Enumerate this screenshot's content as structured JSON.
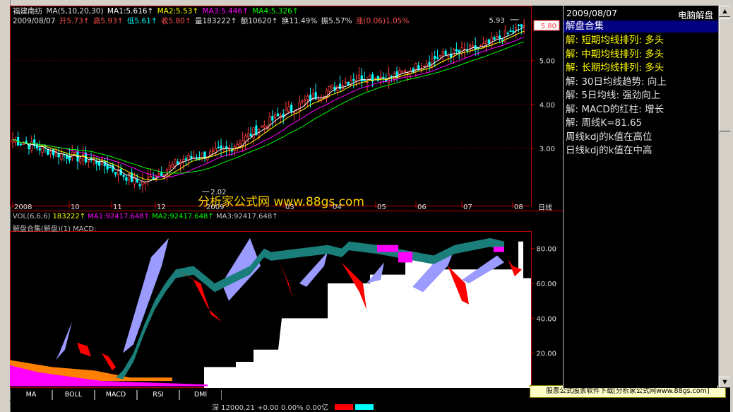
{
  "header": {
    "stock_name": "福建南纺",
    "ma_params": "MA(5,10,20,30)",
    "ma1": "MA1:5.616↑",
    "ma2": "MA2:5.53↑",
    "ma3": "MA3:5.446↑",
    "ma4": "MA4:5.326↑",
    "date": "2009/08/07",
    "open": "开5.73↑",
    "high": "高5.93↑",
    "low": "低5.61↑",
    "close": "收5.80↑",
    "volume": "量183222↑",
    "amount": "额10620↑",
    "turnover": "换11.49%",
    "amplitude": "振5.57%",
    "change": "涨(0.06)1.05%"
  },
  "volume": {
    "params": "VOL(6,6,6)",
    "value": "183222↑",
    "ma1": "MA1:92417.648↑",
    "ma2": "MA2:92417.648↑",
    "ma3": "MA3:92417.648↑"
  },
  "indicator": {
    "title": "解盘合集(解盘)(1) MACD:"
  },
  "watermark": {
    "text": "分析家公式网 www.88gs.com"
  },
  "tabs": [
    "MA",
    "BOLL",
    "MACD",
    "RSI",
    "DMI"
  ],
  "ad": {
    "text": "股票公式股票软件下载[分析家公式网www.88gs.com]"
  },
  "ticker": {
    "text": "深 12000.21 +0.00 0.00% 0.00亿"
  },
  "side": {
    "date": "2009/08/07",
    "title": "电脑解盘",
    "section": "解盘合集",
    "lines": [
      {
        "text": "解: 短期均线排列: 多头",
        "color": "#ffff00"
      },
      {
        "text": "解: 中期均线排列: 多头",
        "color": "#ffff00"
      },
      {
        "text": "解: 长期均线排列: 多头",
        "color": "#ffff00"
      },
      {
        "text": "解: 30日均线趋势: 向上",
        "color": "#e0e0e0"
      },
      {
        "text": "解: 5日均线: 强劲向上",
        "color": "#e0e0e0"
      },
      {
        "text": "解: MACD的红柱: 增长",
        "color": "#e0e0e0"
      },
      {
        "text": "解: 周线K=81.65",
        "color": "#e0e0e0"
      },
      {
        "text": "周线kdj的k值在高位",
        "color": "#e0e0e0"
      },
      {
        "text": "日线kdj的k值在中高",
        "color": "#e0e0e0"
      }
    ]
  },
  "colors": {
    "up": "#ff3c3c",
    "down": "#00ffff",
    "ma1": "#ffffff",
    "ma2": "#ffff00",
    "ma3": "#ff00ff",
    "ma4": "#00ff00",
    "axis": "#c00000",
    "band_purple": "#9a9aff",
    "band_teal": "#1a7f7a",
    "band_red": "#ff0000",
    "band_white": "#ffffff",
    "band_orange": "#ff8000",
    "band_magenta": "#ff00ff"
  },
  "chart_data": [
    {
      "type": "candlestick",
      "title": "福建南纺",
      "xlabel": "日线",
      "x_tick_labels": [
        "2008",
        "10",
        "11",
        "12",
        "2009",
        "03",
        "04",
        "05",
        "06",
        "07",
        "08"
      ],
      "y_tick_labels": [
        "3.00",
        "4.00",
        "5.00"
      ],
      "ylim": [
        1.7,
        6.25
      ],
      "annotations": [
        {
          "label": "5.93",
          "type": "high_marker",
          "value": 5.93
        },
        {
          "label": "2.02",
          "type": "low_marker",
          "value": 2.02
        },
        {
          "label": "5.80",
          "type": "last_price_box",
          "value": 5.8
        }
      ],
      "series_trend": {
        "x": [
          "2008-08",
          "2008-09",
          "2008-10",
          "2008-11",
          "2008-12",
          "2009-01",
          "2009-02",
          "2009-03",
          "2009-04",
          "2009-05",
          "2009-06",
          "2009-07",
          "2009-08"
        ],
        "close": [
          3.2,
          2.9,
          2.7,
          2.2,
          2.75,
          2.95,
          3.6,
          4.15,
          4.6,
          4.65,
          5.1,
          5.3,
          5.8
        ]
      }
    },
    {
      "type": "area",
      "title": "解盘合集(解盘)(1) MACD:",
      "y_tick_labels": [
        "20.00",
        "40.00",
        "60.00",
        "80.00"
      ],
      "ylim": [
        0,
        90
      ],
      "series": [
        {
          "name": "purple",
          "color": "#9a9aff"
        },
        {
          "name": "teal",
          "color": "#1a7f7a"
        },
        {
          "name": "red",
          "color": "#ff0000"
        },
        {
          "name": "white",
          "color": "#ffffff"
        },
        {
          "name": "orange",
          "color": "#ff8000"
        },
        {
          "name": "magenta",
          "color": "#ff00ff"
        }
      ]
    }
  ]
}
